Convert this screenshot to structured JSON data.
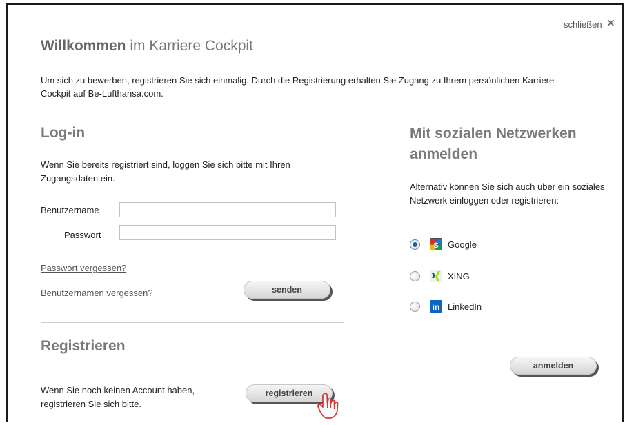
{
  "dialog": {
    "close_label": "schließen",
    "title_bold": "Willkommen",
    "title_rest": " im Karriere Cockpit",
    "intro_text": "Um sich zu bewerben, registrieren Sie sich einmalig. Durch die Registrierung erhalten Sie Zugang zu Ihrem persönlichen Karriere Cockpit auf Be-Lufthansa.com."
  },
  "login": {
    "heading": "Log-in",
    "description": "Wenn Sie bereits registriert sind, loggen Sie sich bitte mit Ihren Zugangsdaten ein.",
    "username_label": "Benutzername",
    "username_value": "",
    "password_label": "Passwort",
    "password_value": "",
    "forgot_password": "Passwort vergessen?",
    "forgot_username": "Benutzernamen vergessen?",
    "submit_label": "senden"
  },
  "register": {
    "heading": "Registrieren",
    "description": "Wenn Sie noch keinen Account haben, registrieren Sie sich bitte.",
    "button_label": "registrieren"
  },
  "social": {
    "heading": "Mit sozialen Netzwerken anmelden",
    "description": "Alternativ können Sie sich auch über ein soziales Netzwerk einloggen oder registrieren:",
    "options": [
      {
        "label": "Google",
        "icon": "google-icon",
        "selected": true
      },
      {
        "label": "XING",
        "icon": "xing-icon",
        "selected": false
      },
      {
        "label": "LinkedIn",
        "icon": "linkedin-icon",
        "selected": false
      }
    ],
    "button_label": "anmelden"
  }
}
